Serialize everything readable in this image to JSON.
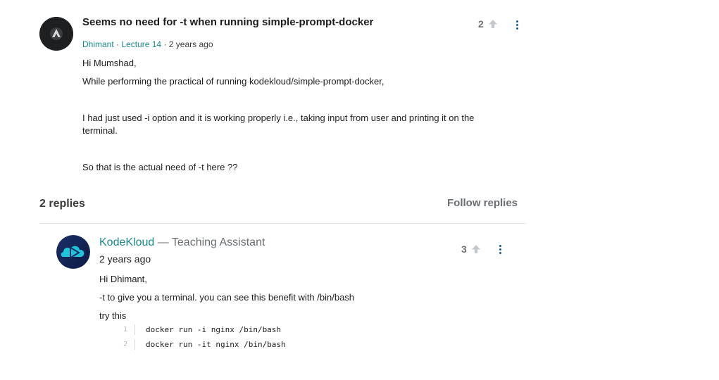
{
  "question": {
    "title": "Seems no need for -t when running simple-prompt-docker",
    "author": "Dhimant",
    "separator1": "·",
    "lecture": "Lecture 14",
    "separator2": "·",
    "time": "2 years ago",
    "upvotes": "2",
    "paragraphs": [
      "Hi Mumshad,",
      "While performing the practical of running kodekloud/simple-prompt-docker,",
      "I had just used -i option and it is working properly i.e., taking input from user and printing it on the terminal.",
      "So that is the actual need of -t here ??"
    ]
  },
  "replies_section": {
    "count_label": "2 replies",
    "follow_label": "Follow replies"
  },
  "reply": {
    "author": "KodeKloud",
    "role": " — Teaching Assistant",
    "time": "2 years ago",
    "upvotes": "3",
    "paragraphs": [
      "Hi Dhimant,",
      "-t to give you a terminal. you can see this benefit with /bin/bash",
      "try this"
    ],
    "code": [
      {
        "line": "1",
        "text": "docker run -i nginx /bin/bash"
      },
      {
        "line": "2",
        "text": "docker run -it nginx /bin/bash"
      }
    ]
  },
  "colors": {
    "link": "#1a8a88",
    "kebab": "#1b5e8c",
    "muted": "#6a6f73"
  },
  "icons": {
    "upvote": "arrow-up-icon",
    "more": "kebab-menu-icon"
  }
}
